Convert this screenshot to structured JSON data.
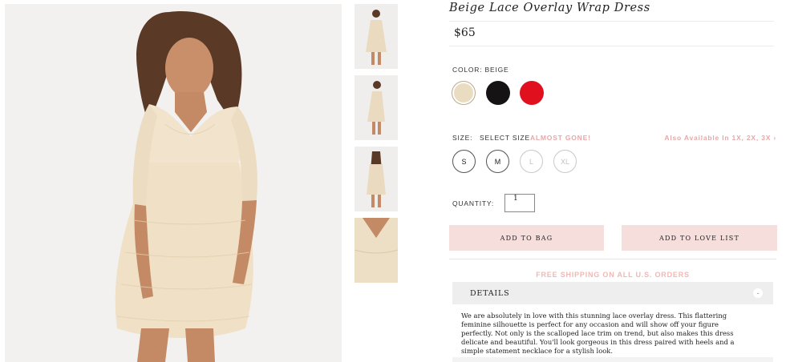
{
  "product": {
    "title": "Beige Lace Overlay Wrap Dress",
    "price": "$65"
  },
  "color": {
    "label": "COLOR: BEIGE",
    "swatches": [
      {
        "name": "Beige",
        "hex": "#e9dcc0",
        "selected": true
      },
      {
        "name": "Black",
        "hex": "#151313",
        "selected": false
      },
      {
        "name": "Red",
        "hex": "#e0101e",
        "selected": false
      }
    ]
  },
  "size": {
    "label": "SIZE:",
    "select_text": "SELECT SIZE",
    "almost_gone": "ALMOST GONE!",
    "also_available": "Also Available In 1X, 2X, 3X ›",
    "options": [
      {
        "label": "S",
        "available": true
      },
      {
        "label": "M",
        "available": true
      },
      {
        "label": "L",
        "available": false
      },
      {
        "label": "XL",
        "available": false
      }
    ]
  },
  "quantity": {
    "label": "QUANTITY:",
    "value": "1"
  },
  "actions": {
    "add_to_bag": "ADD TO BAG",
    "add_to_love_list": "ADD TO LOVE LIST"
  },
  "shipping_text": "FREE SHIPPING ON ALL U.S. ORDERS",
  "details": {
    "title": "DETAILS",
    "toggle_symbol": "-",
    "text": "We are absolutely in love with this stunning lace overlay dress. This flattering feminine silhouette is perfect for any occasion and will show off your figure perfectly. Not only is the scalloped lace trim on trend, but also makes this dress delicate and beautiful. You'll look gorgeous in this dress paired with heels and a simple statement necklace for a stylish look."
  },
  "colors": {
    "accent_pink": "#f5dedc",
    "alert_pink": "#e8a8a8"
  }
}
